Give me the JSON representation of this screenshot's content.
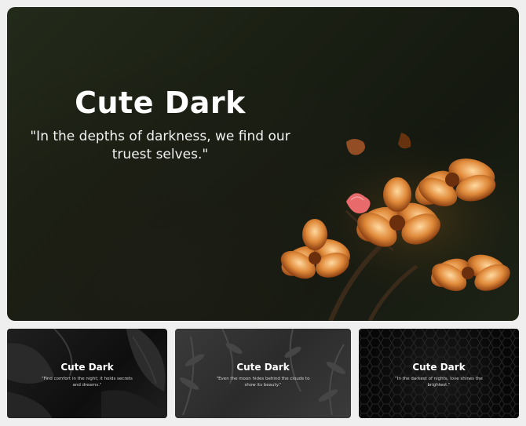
{
  "main_slide": {
    "title": "Cute Dark",
    "quote": "\"In the depths of darkness, we find our truest selves.\""
  },
  "thumbnails": [
    {
      "title": "Cute Dark",
      "quote": "\"Find comfort in the night; it holds secrets and dreams.\""
    },
    {
      "title": "Cute Dark",
      "quote": "\"Even the moon hides behind the clouds to show its beauty.\""
    },
    {
      "title": "Cute Dark",
      "quote": "\"In the darkest of nights, love shines the brightest.\""
    }
  ],
  "colors": {
    "flower_orange": "#e08a3a",
    "flower_pink": "#e86a6a"
  }
}
